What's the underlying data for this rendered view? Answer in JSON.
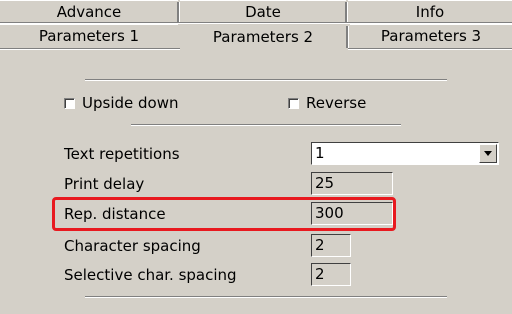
{
  "tabs": {
    "row1": [
      "Advance",
      "Date",
      "Info"
    ],
    "row2": [
      "Parameters 1",
      "Parameters 2",
      "Parameters 3"
    ],
    "active": "Parameters 2"
  },
  "options": {
    "upside_down": {
      "label": "Upside down",
      "checked": false
    },
    "reverse": {
      "label": "Reverse",
      "checked": false
    }
  },
  "fields": {
    "text_repetitions": {
      "label": "Text repetitions",
      "value": "1"
    },
    "print_delay": {
      "label": "Print delay",
      "value": "25"
    },
    "rep_distance": {
      "label": "Rep. distance",
      "value": "300"
    },
    "character_spacing": {
      "label": "Character spacing",
      "value": "2"
    },
    "selective_char_spacing": {
      "label": "Selective char. spacing",
      "value": "2"
    }
  },
  "colors": {
    "highlight": "#e8191f",
    "background": "#d4d0c8"
  }
}
